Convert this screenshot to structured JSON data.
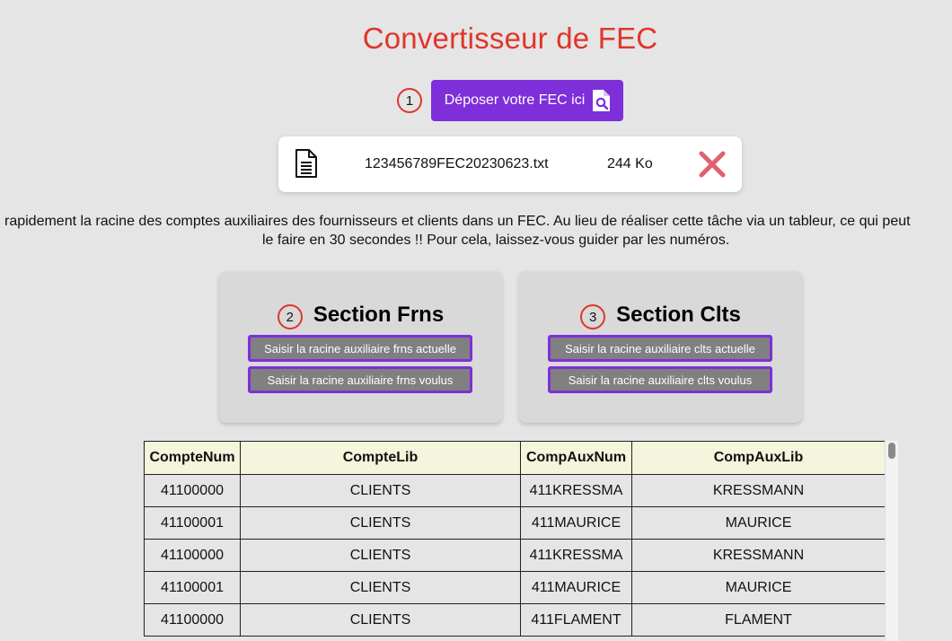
{
  "header": {
    "title": "Convertisseur de FEC"
  },
  "upload": {
    "step": "1",
    "button_label": "Déposer votre FEC ici",
    "icon": "file-search-icon"
  },
  "file": {
    "name": "123456789FEC20230623.txt",
    "size": "244 Ko",
    "file_icon": "document-icon",
    "remove_icon": "close-icon"
  },
  "description": {
    "line1": "rapidement la racine des comptes auxiliaires des fournisseurs et clients dans un FEC. Au lieu de réaliser cette tâche via un tableur, ce qui peut",
    "line2": "le faire en 30 secondes !! Pour cela, laissez-vous guider par les numéros."
  },
  "sections": {
    "frns": {
      "step": "2",
      "title": "Section Frns",
      "button_current": "Saisir la racine auxiliaire frns actuelle",
      "button_wanted": "Saisir la racine auxiliaire frns voulus"
    },
    "clts": {
      "step": "3",
      "title": "Section Clts",
      "button_current": "Saisir la racine auxiliaire clts actuelle",
      "button_wanted": "Saisir la racine auxiliaire clts voulus"
    }
  },
  "table": {
    "headers": [
      "CompteNum",
      "CompteLib",
      "CompAuxNum",
      "CompAuxLib"
    ],
    "rows": [
      [
        "41100000",
        "CLIENTS",
        "411KRESSMA",
        "KRESSMANN"
      ],
      [
        "41100001",
        "CLIENTS",
        "411MAURICE",
        "MAURICE"
      ],
      [
        "41100000",
        "CLIENTS",
        "411KRESSMA",
        "KRESSMANN"
      ],
      [
        "41100001",
        "CLIENTS",
        "411MAURICE",
        "MAURICE"
      ],
      [
        "41100000",
        "CLIENTS",
        "411FLAMENT",
        "FLAMENT"
      ]
    ]
  },
  "colors": {
    "accent": "#7e2fd9",
    "title": "#e0352b",
    "remove": "#e0606e"
  }
}
